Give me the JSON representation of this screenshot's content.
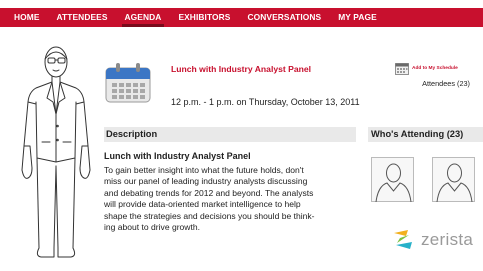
{
  "nav": {
    "items": [
      {
        "label": "HOME"
      },
      {
        "label": "ATTENDEES"
      },
      {
        "label": "AGENDA",
        "active": true
      },
      {
        "label": "EXHIBITORS"
      },
      {
        "label": "CONVERSATIONS"
      },
      {
        "label": "MY PAGE"
      }
    ]
  },
  "event": {
    "title": "Lunch with Industry Analyst Panel",
    "time": "12 p.m. - 1 p.m. on Thursday, October 13, 2011",
    "add_to_schedule": "Add to My Schedule",
    "attendees": "Attendees (23)"
  },
  "description": {
    "heading": "Description",
    "subtitle": "Lunch with Industry Analyst Panel",
    "lines": [
      "To gain better insight into what the future holds, don't",
      "miss our panel of leading industry analysts discussing",
      "and debating trends for 2012 and beyond. The analysts",
      "will provide data-oriented market intelligence to help",
      "shape the strategies and decisions you should be think-",
      "ing about to drive growth."
    ]
  },
  "attending": {
    "heading": "Who's Attending (23)"
  },
  "brand": {
    "name": "zerista"
  },
  "colors": {
    "brand_red": "#c8102e",
    "section_bg": "#e9e9e9"
  }
}
